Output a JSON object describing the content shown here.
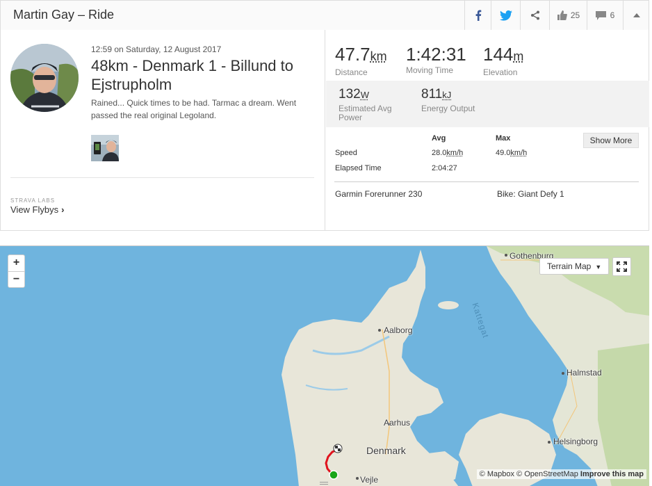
{
  "header": {
    "title": "Martin Gay – Ride",
    "kudos_count": "25",
    "comment_count": "6"
  },
  "activity": {
    "datetime": "12:59 on Saturday, 12 August 2017",
    "title": "48km - Denmark 1 - Billund to Ejstrupholm",
    "description": "Rained... Quick times to be had. Tarmac a dream. Went passed the real original Legoland.",
    "labs_label": "STRAVA LABS",
    "flybys_label": "View Flybys"
  },
  "stats": {
    "distance": {
      "value": "47.7",
      "unit": "km",
      "label": "Distance"
    },
    "moving_time": {
      "value": "1:42:31",
      "label": "Moving Time"
    },
    "elevation": {
      "value": "144",
      "unit": "m",
      "label": "Elevation"
    },
    "avg_power": {
      "value": "132",
      "unit": "W",
      "label1": "Estimated Avg",
      "label2": "Power"
    },
    "energy": {
      "value": "811",
      "unit": "kJ",
      "label": "Energy Output"
    }
  },
  "table": {
    "col_avg": "Avg",
    "col_max": "Max",
    "rows": [
      {
        "label": "Speed",
        "avg": "28.0",
        "avg_unit": "km/h",
        "max": "49.0",
        "max_unit": "km/h"
      },
      {
        "label": "Elapsed Time",
        "avg": "2:04:27"
      }
    ],
    "show_more": "Show More"
  },
  "gear": {
    "device": "Garmin Forerunner 230",
    "bike": "Bike: Giant Defy 1"
  },
  "map": {
    "zoom_in": "+",
    "zoom_out": "−",
    "style_label": "Terrain Map",
    "places": {
      "gothenburg": "Gothenburg",
      "aalborg": "Aalborg",
      "kattegat": "Kattegat",
      "halmstad": "Halmstad",
      "aarhus": "Aarhus",
      "denmark": "Denmark",
      "helsingborg": "Helsingborg",
      "vejle": "Vejle"
    },
    "attribution_mapbox": "© Mapbox",
    "attribution_osm": "© OpenStreetMap",
    "attribution_improve": "Improve this map"
  },
  "colors": {
    "water": "#6fb4de",
    "land": "#e8e6d9",
    "route": "#e0141e",
    "start": "#1aa61a",
    "facebook": "#3b5998",
    "twitter": "#1da1f2"
  }
}
